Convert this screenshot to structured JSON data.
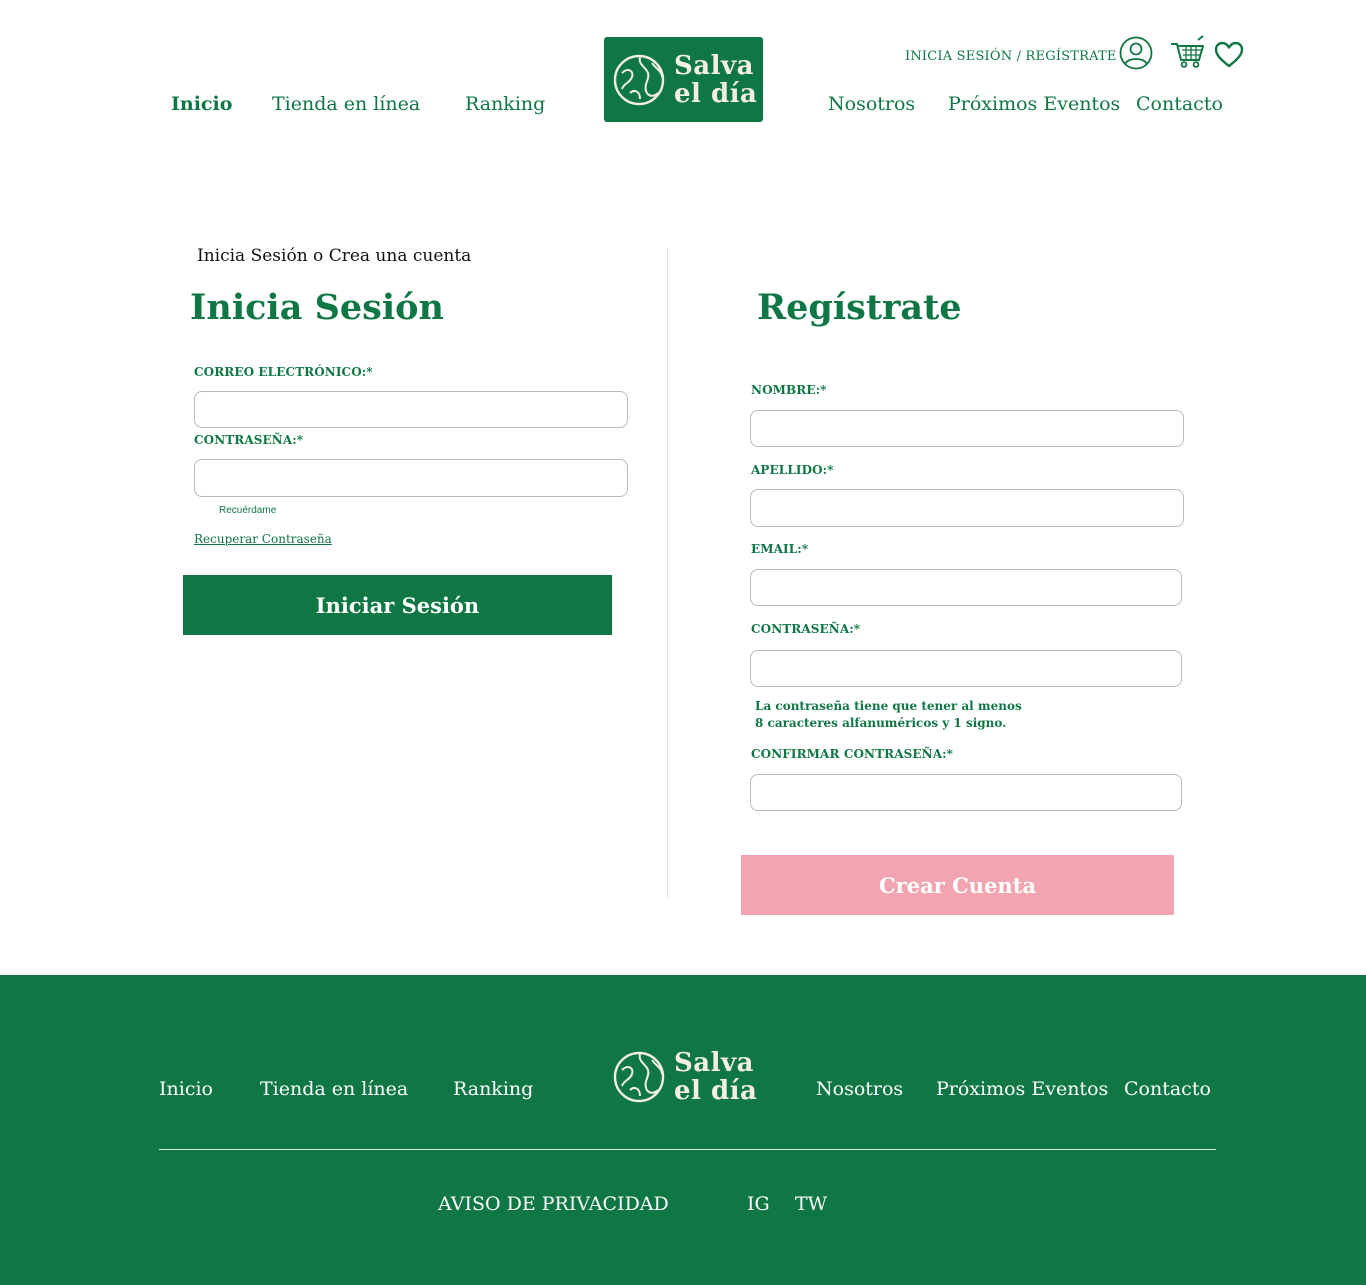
{
  "header": {
    "nav_left": [
      "Inicio",
      "Tienda en línea",
      "Ranking"
    ],
    "nav_right": [
      "Nosotros",
      "Próximos Eventos",
      "Contacto"
    ],
    "logo_line1": "Salva",
    "logo_line2": "el día",
    "auth_link": "INICIA SESIÓN / REGÍSTRATE",
    "icons": [
      "user-icon",
      "cart-icon",
      "heart-icon"
    ]
  },
  "breadcrumb": "Inicia Sesión o Crea una cuenta",
  "login": {
    "title": "Inicia Sesión",
    "email_label": "CORREO ELECTRÓNICO:*",
    "email_value": "",
    "password_label": "CONTRASEÑA:*",
    "password_value": "",
    "remember_label": "Recuérdame",
    "recover_link": "Recuperar Contraseña",
    "submit_label": "Iniciar Sesión"
  },
  "register": {
    "title": "Regístrate",
    "name_label": "NOMBRE:*",
    "lastname_label": "APELLIDO:*",
    "email_label": "EMAIL:*",
    "password_label": "CONTRASEÑA:*",
    "password_hint_1": "La contraseña tiene que tener al menos",
    "password_hint_2": "8 caracteres alfanuméricos y 1 signo.",
    "confirm_label": "CONFIRMAR CONTRASEÑA:*",
    "submit_label": "Crear Cuenta"
  },
  "footer": {
    "nav_left": [
      "Inicio",
      "Tienda en línea",
      "Ranking"
    ],
    "nav_right": [
      "Nosotros",
      "Próximos Eventos",
      "Contacto"
    ],
    "logo_line1": "Salva",
    "logo_line2": "el día",
    "privacy": "AVISO DE PRIVACIDAD",
    "social": [
      "IG",
      "TW"
    ]
  },
  "colors": {
    "brand_green": "#0e7743",
    "cta_pink": "#f2a5b0",
    "logo_text": "#f4efe2"
  }
}
